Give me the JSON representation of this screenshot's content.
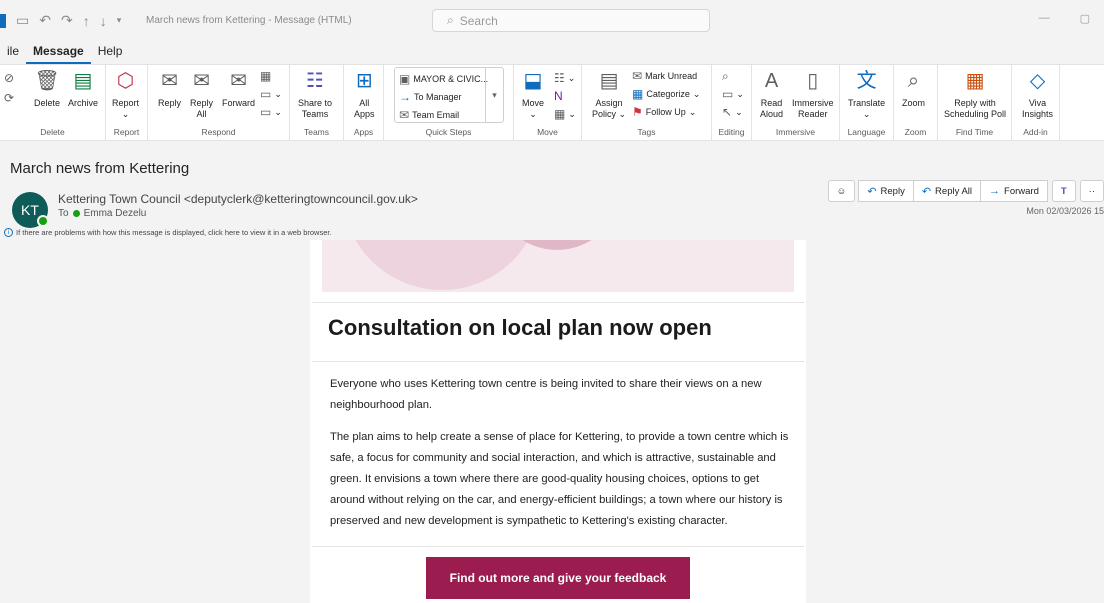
{
  "window": {
    "title": "March news from Kettering  -  Message (HTML)",
    "search_placeholder": "Search"
  },
  "menu": [
    "ile",
    "Message",
    "Help"
  ],
  "ribbon": {
    "delete_group": {
      "label": "Delete",
      "delete": "Delete",
      "archive": "Archive"
    },
    "report_group": {
      "label": "Report",
      "report": "Report"
    },
    "respond_group": {
      "label": "Respond",
      "reply": "Reply",
      "reply_all_1": "Reply",
      "reply_all_2": "All",
      "forward": "Forward"
    },
    "teams_group": {
      "label": "Teams",
      "share_1": "Share to",
      "share_2": "Teams"
    },
    "apps_group": {
      "label": "Apps",
      "all_1": "All",
      "all_2": "Apps"
    },
    "quicksteps_group": {
      "label": "Quick Steps",
      "items": [
        "MAYOR & CIVIC...",
        "To Manager",
        "Team Email"
      ]
    },
    "move_group": {
      "label": "Move",
      "move": "Move"
    },
    "tags_group": {
      "label": "Tags",
      "assign_1": "Assign",
      "assign_2": "Policy",
      "mark_unread": "Mark Unread",
      "categorize": "Categorize",
      "follow_up": "Follow Up"
    },
    "editing_group": {
      "label": "Editing"
    },
    "immersive_group": {
      "label": "Immersive",
      "read_1": "Read",
      "read_2": "Aloud",
      "imm_1": "Immersive",
      "imm_2": "Reader"
    },
    "language_group": {
      "label": "Language",
      "translate": "Translate"
    },
    "zoom_group": {
      "label": "Zoom",
      "zoom": "Zoom"
    },
    "findtime_group": {
      "label": "Find Time",
      "reply_1": "Reply with",
      "reply_2": "Scheduling Poll"
    },
    "addin_group": {
      "label": "Add-in",
      "viva_1": "Viva",
      "viva_2": "Insights"
    }
  },
  "message": {
    "subject": "March news from Kettering",
    "avatar": "KT",
    "sender": "Kettering Town Council <deputyclerk@ketteringtowncouncil.gov.uk>",
    "to_label": "To",
    "to_name": "Emma Dezelu",
    "info": "If there are problems with how this message is displayed, click here to view it in a web browser.",
    "date": "Mon 02/03/2026 15",
    "actions": {
      "reply": "Reply",
      "reply_all": "Reply All",
      "forward": "Forward"
    }
  },
  "email": {
    "headline": "Consultation on local plan now open",
    "para1": "Everyone who uses Kettering town centre is being invited to share their views on a new neighbourhood plan.",
    "para2": "The plan aims to help create a sense of place for Kettering, to provide a town centre which is safe, a focus for community and social interaction, and which is attractive, sustainable and green. It envisions a town where there are good-quality housing choices, options to get around without relying on the car, and energy-efficient buildings; a town where our history is preserved and new development is sympathetic to Kettering's existing character.",
    "cta": "Find out more and give your feedback"
  },
  "colors": {
    "accent": "#0f6cbd",
    "cta": "#9b1c4f",
    "avatar": "#0e5b57"
  }
}
